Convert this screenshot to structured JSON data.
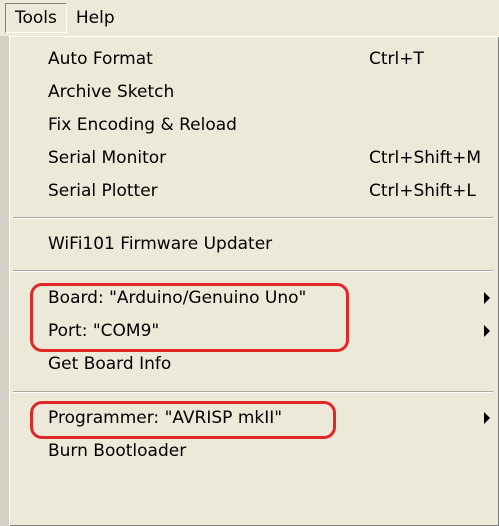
{
  "menubar": {
    "items": [
      "Tools",
      "Help"
    ]
  },
  "menu": {
    "items": [
      {
        "label": "Auto Format",
        "shortcut": "Ctrl+T"
      },
      {
        "label": "Archive Sketch",
        "shortcut": ""
      },
      {
        "label": "Fix Encoding & Reload",
        "shortcut": ""
      },
      {
        "label": "Serial Monitor",
        "shortcut": "Ctrl+Shift+M"
      },
      {
        "label": "Serial Plotter",
        "shortcut": "Ctrl+Shift+L"
      },
      {
        "label": "WiFi101 Firmware Updater",
        "shortcut": ""
      },
      {
        "label": "Board: \"Arduino/Genuino Uno\"",
        "shortcut": "",
        "submenu": true
      },
      {
        "label": "Port: \"COM9\"",
        "shortcut": "",
        "submenu": true
      },
      {
        "label": "Get Board Info",
        "shortcut": ""
      },
      {
        "label": "Programmer: \"AVRISP mkII\"",
        "shortcut": "",
        "submenu": true
      },
      {
        "label": "Burn Bootloader",
        "shortcut": ""
      }
    ]
  },
  "colors": {
    "menu_background": "#ece9d8",
    "highlight_outline": "#e32626"
  },
  "icons": [
    "submenu-arrow-icon"
  ]
}
